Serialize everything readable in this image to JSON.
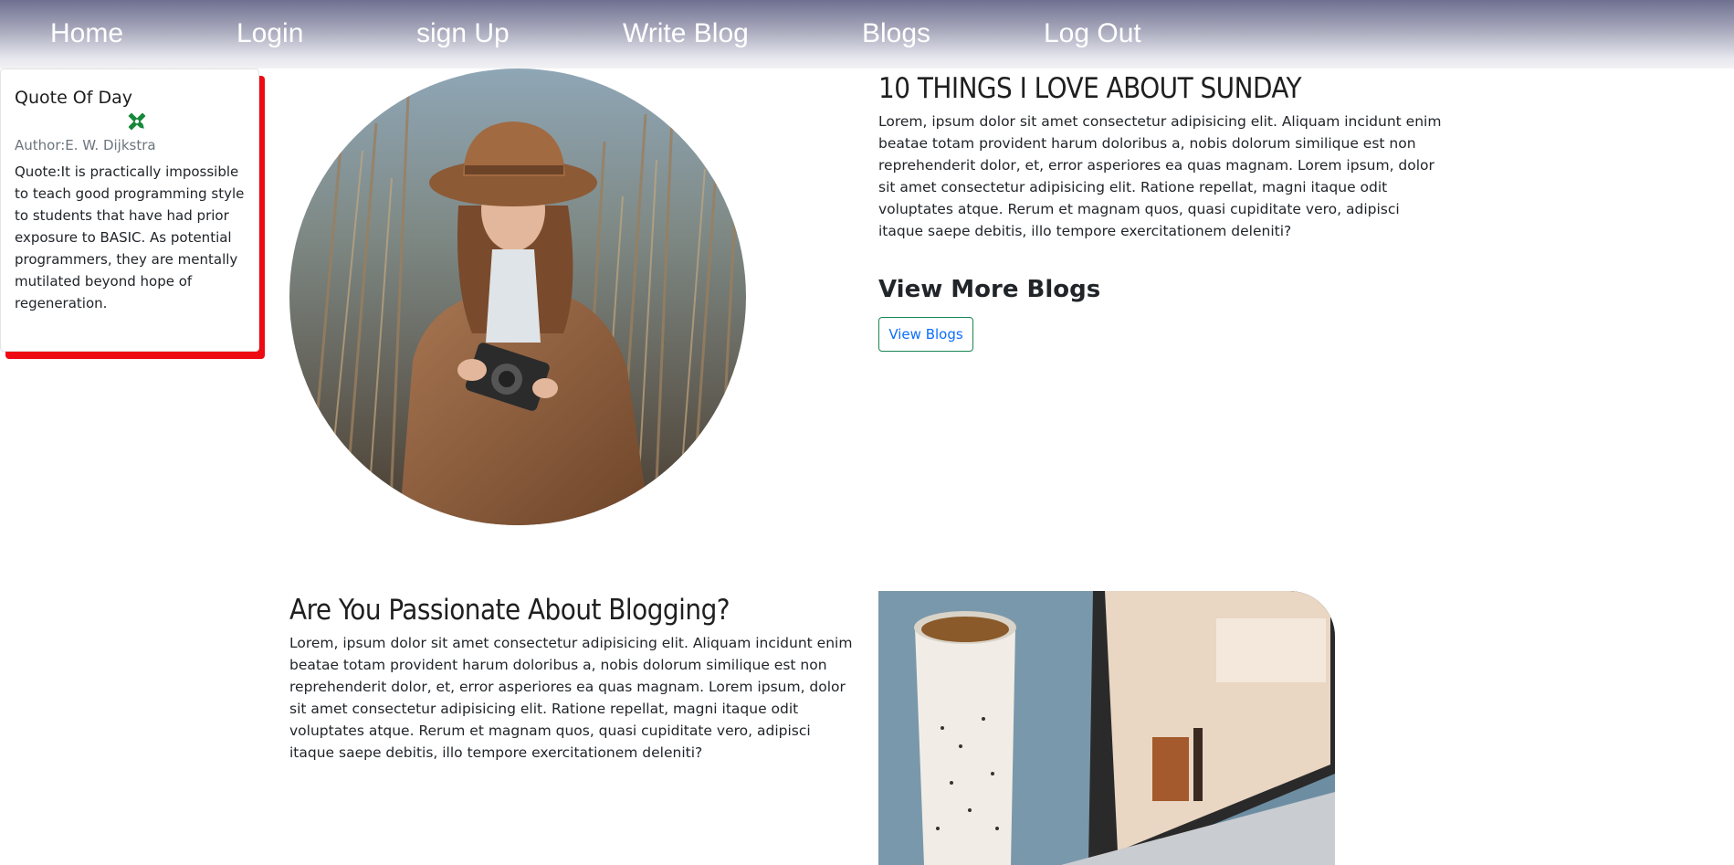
{
  "nav": {
    "items": [
      "Home",
      "Login",
      "sign Up",
      "Write Blog",
      "Blogs",
      "Log Out"
    ]
  },
  "quote_card": {
    "title": "Quote Of Day",
    "author": "Author:E. W. Dijkstra",
    "quote": "Quote:It is practically impossible to teach good programming style to students that have had prior exposure to BASIC. As potential programmers, they are mentally mutilated beyond hope of regeneration.",
    "icon": "pencil-ruler-icon",
    "shadow_color": "#ee0a12",
    "icon_color": "#15883a"
  },
  "hero": {
    "image": "woman-with-camera-photo",
    "blog_title": "10 THINGS I LOVE ABOUT SUNDAY",
    "blog_body": "Lorem, ipsum dolor sit amet consectetur adipisicing elit. Aliquam incidunt enim beatae totam provident harum doloribus a, nobis dolorum similique est non reprehenderit dolor, et, error asperiores ea quas magnam. Lorem ipsum, dolor sit amet consectetur adipisicing elit. Ratione repellat, magni itaque odit voluptates atque. Rerum et magnam quos, quasi cupiditate vero, adipisci itaque saepe debitis, illo tempore exercitationem deleniti?"
  },
  "more_blogs": {
    "heading": "View More Blogs",
    "button_label": "View Blogs",
    "button_text_color": "#0d6efd",
    "button_border_color": "#198754"
  },
  "passion": {
    "title": "Are You Passionate About Blogging?",
    "body": "Lorem, ipsum dolor sit amet consectetur adipisicing elit. Aliquam incidunt enim beatae totam provident harum doloribus a, nobis dolorum similique est non reprehenderit dolor, et, error asperiores ea quas magnam. Lorem ipsum, dolor sit amet consectetur adipisicing elit. Ratione repellat, magni itaque odit voluptates atque. Rerum et magnam quos, quasi cupiditate vero, adipisci itaque saepe debitis, illo tempore exercitationem deleniti?",
    "image": "coffee-mug-laptop-photo"
  }
}
